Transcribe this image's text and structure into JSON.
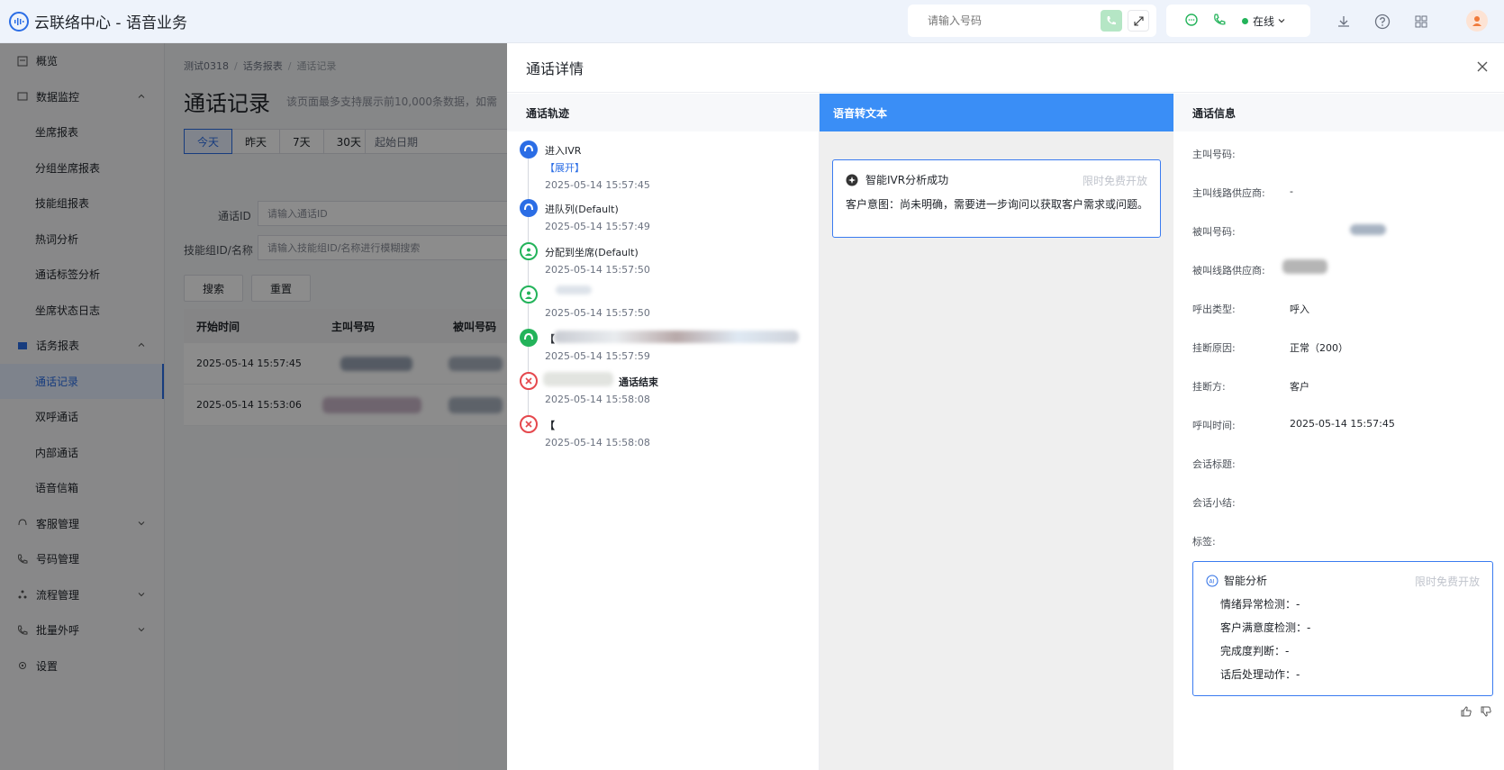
{
  "app": {
    "title": "云联络中心 - 语音业务"
  },
  "topbar": {
    "phone_placeholder": "请输入号码",
    "status_label": "在线",
    "accent": "#2b6de5"
  },
  "sidebar": {
    "items": [
      {
        "label": "概览",
        "icon": "overview-icon"
      },
      {
        "label": "数据监控",
        "icon": "monitor-icon"
      },
      {
        "label": "坐席报表"
      },
      {
        "label": "分组坐席报表"
      },
      {
        "label": "技能组报表"
      },
      {
        "label": "热词分析"
      },
      {
        "label": "通话标签分析"
      },
      {
        "label": "坐席状态日志"
      },
      {
        "label": "话务报表",
        "icon": "report-icon"
      },
      {
        "label": "通话记录"
      },
      {
        "label": "双呼通话"
      },
      {
        "label": "内部通话"
      },
      {
        "label": "语音信箱"
      },
      {
        "label": "客服管理",
        "icon": "headset-icon"
      },
      {
        "label": "号码管理",
        "icon": "phone-icon"
      },
      {
        "label": "流程管理",
        "icon": "flow-icon"
      },
      {
        "label": "批量外呼",
        "icon": "outbound-icon"
      },
      {
        "label": "设置",
        "icon": "settings-icon"
      }
    ]
  },
  "main": {
    "breadcrumb": [
      "测试0318",
      "话务报表",
      "通话记录"
    ],
    "title": "通话记录",
    "note": "该页面最多支持展示前10,000条数据，如需",
    "ranges": [
      "今天",
      "昨天",
      "7天",
      "30天"
    ],
    "date_start": "起始日期",
    "call_id_label": "通话ID",
    "call_id_placeholder": "请输入通话ID",
    "skill_label": "技能组ID/名称",
    "skill_placeholder": "请输入技能组ID/名称进行模糊搜索",
    "search_btn": "搜索",
    "reset_btn": "重置",
    "columns": [
      "开始时间",
      "主叫号码",
      "被叫号码"
    ],
    "rows": [
      {
        "start": "2025-05-14 15:57:45"
      },
      {
        "start": "2025-05-14 15:53:06"
      }
    ]
  },
  "drawer": {
    "title": "通话详情",
    "track_title": "通话轨迹",
    "stt_title": "语音转文本",
    "info_title": "通话信息",
    "timeline": [
      {
        "title": "进入IVR",
        "extra": "【展开】",
        "time": "2025-05-14 15:57:45",
        "color": "#2b6de5"
      },
      {
        "title": "进队列(Default)",
        "time": "2025-05-14 15:57:49",
        "color": "#2b6de5"
      },
      {
        "title": "分配到坐席(Default)",
        "time": "2025-05-14 15:57:50",
        "color": "#23b35a"
      },
      {
        "title": "",
        "time": "2025-05-14 15:57:50",
        "color": "#23b35a"
      },
      {
        "title": "【",
        "time": "2025-05-14 15:57:59",
        "color": "#23b35a"
      },
      {
        "title": "通话结束",
        "time": "2025-05-14 15:58:08",
        "color": "#e5484d"
      },
      {
        "title": "【",
        "time": "2025-05-14 15:58:08",
        "color": "#e5484d"
      }
    ],
    "ivr_card": {
      "title": "智能IVR分析成功",
      "badge": "限时免费开放",
      "body": "客户意图：尚未明确，需要进一步询问以获取客户需求或问题。"
    },
    "info": [
      {
        "k": "主叫号码:",
        "v": ""
      },
      {
        "k": "主叫线路供应商:",
        "v": "-"
      },
      {
        "k": "被叫号码:",
        "v": ""
      },
      {
        "k": "被叫线路供应商:",
        "v": ""
      },
      {
        "k": "呼出类型:",
        "v": "呼入"
      },
      {
        "k": "挂断原因:",
        "v": "正常（200）"
      },
      {
        "k": "挂断方:",
        "v": "客户"
      },
      {
        "k": "呼叫时间:",
        "v": "2025-05-14 15:57:45"
      },
      {
        "k": "会话标题:",
        "v": ""
      },
      {
        "k": "会话小结:",
        "v": ""
      },
      {
        "k": "标签:",
        "v": ""
      }
    ],
    "ai": {
      "title": "智能分析",
      "badge": "限时免费开放",
      "rows": [
        "情绪异常检测：-",
        "客户满意度检测：-",
        "完成度判断：-",
        "话后处理动作：-"
      ]
    }
  }
}
